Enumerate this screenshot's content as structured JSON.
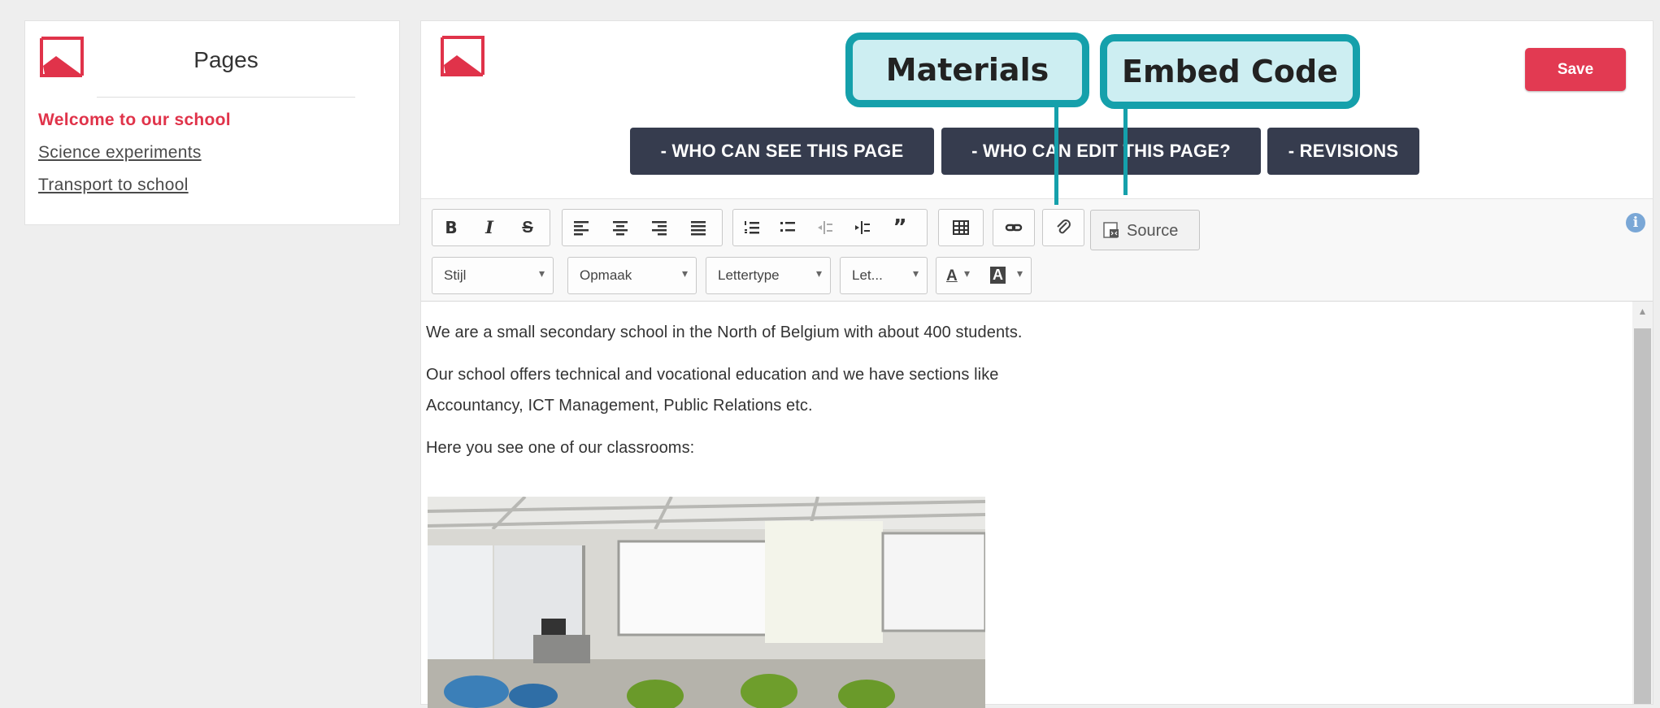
{
  "sidebar": {
    "title": "Pages",
    "items": [
      {
        "label": "Welcome to our school",
        "active": true
      },
      {
        "label": "Science experiments",
        "active": false
      },
      {
        "label": "Transport to school",
        "active": false
      }
    ]
  },
  "header": {
    "save_label": "Save",
    "buttons": [
      {
        "label": "- WHO CAN SEE THIS PAGE"
      },
      {
        "label": "- WHO CAN EDIT THIS PAGE?"
      },
      {
        "label": "- REVISIONS"
      }
    ]
  },
  "callouts": {
    "materials": "Materials",
    "embed_code": "Embed Code"
  },
  "toolbar": {
    "source_label": "Source",
    "combos": [
      {
        "label": "Stijl"
      },
      {
        "label": "Opmaak"
      },
      {
        "label": "Lettertype"
      },
      {
        "label": "Let..."
      }
    ],
    "text_color_label": "A",
    "bg_color_label": "A"
  },
  "content": {
    "paragraphs": [
      "We are a small secondary school in the North of Belgium with about 400 students.",
      "Our school offers technical and vocational education and we have sections like",
      "Accountancy, ICT Management, Public Relations etc.",
      "Here you see one of our classrooms:"
    ]
  },
  "colors": {
    "accent": "#e0334a",
    "dark_button": "#363c4e",
    "callout_border": "#15a0ab",
    "callout_fill": "#cdeef2"
  }
}
